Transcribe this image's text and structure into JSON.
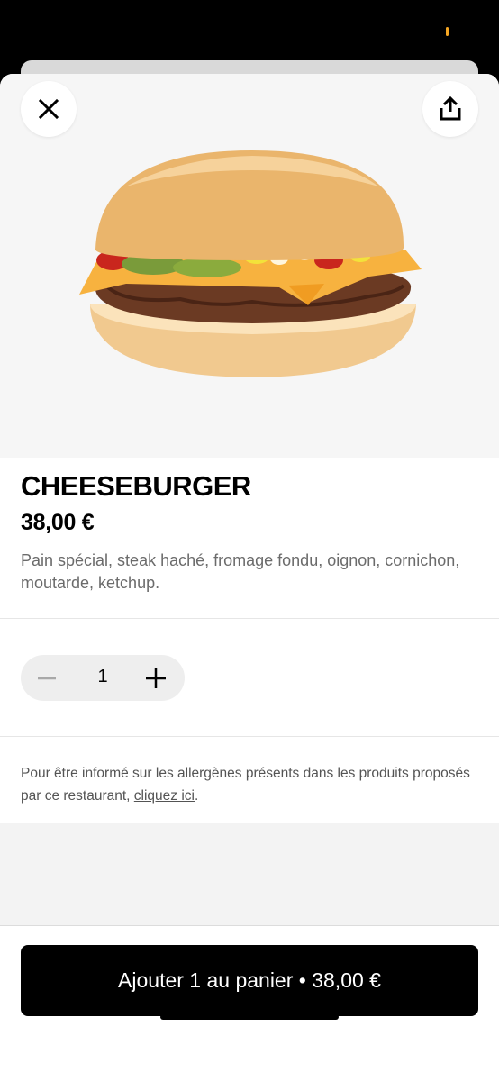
{
  "product": {
    "title": "CHEESEBURGER",
    "price": "38,00 €",
    "description": "Pain spécial, steak haché, fromage fondu, oignon, cornichon, moutarde, ketchup."
  },
  "quantity": {
    "value": "1"
  },
  "allergen": {
    "text": "Pour être informé sur les allergènes présents dans les produits proposés par ce restaurant, ",
    "link": "cliquez ici",
    "suffix": "."
  },
  "cart": {
    "button_label": "Ajouter 1 au panier • 38,00 €"
  },
  "icons": {
    "close": "close-icon",
    "share": "share-icon",
    "minus": "minus-icon",
    "plus": "plus-icon"
  },
  "colors": {
    "primary": "#000000",
    "status_accent": "#f5a623",
    "hero_background": "#f6f6f6",
    "stepper_background": "#eeeeee"
  }
}
